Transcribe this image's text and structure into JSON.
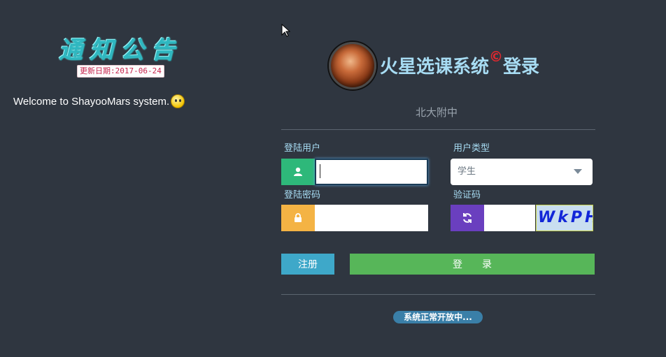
{
  "notice": {
    "title": "通知公告",
    "update_date": "更新日期:2017-06-24",
    "welcome_text": "Welcome to ShayooMars system.",
    "emoji_icon": "smiley-icon"
  },
  "header": {
    "title_main": "火星选课系统",
    "title_mark": "©",
    "title_suffix": "登录",
    "school": "北大附中",
    "logo_icon": "mars-planet-icon"
  },
  "form": {
    "username_label": "登陆用户",
    "username_value": "",
    "user_type_label": "用户类型",
    "user_type_selected": "学生",
    "password_label": "登陆密码",
    "password_value": "",
    "captcha_label": "验证码",
    "captcha_value": "",
    "captcha_text": "WkPH"
  },
  "buttons": {
    "register": "注册",
    "login": "登　　录"
  },
  "status": {
    "text": "系统正常开放中..."
  },
  "colors": {
    "background": "#2f3640",
    "user_addon": "#2eb87a",
    "password_addon": "#f4b344",
    "captcha_addon": "#6a3fbf",
    "register_button": "#3ea8c9",
    "login_button": "#57b659",
    "label_text": "#a7dcf3"
  }
}
